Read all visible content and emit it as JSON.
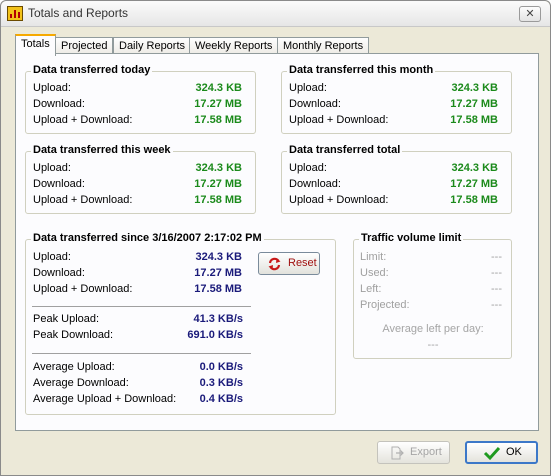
{
  "window": {
    "title": "Totals and Reports",
    "close_glyph": "✕"
  },
  "tabs": [
    "Totals",
    "Projected",
    "Daily Reports",
    "Weekly Reports",
    "Monthly Reports"
  ],
  "today": {
    "title": "Data transferred today",
    "upload_label": "Upload:",
    "upload": "324.3 KB",
    "download_label": "Download:",
    "download": "17.27 MB",
    "total_label": "Upload + Download:",
    "total": "17.58 MB"
  },
  "month": {
    "title": "Data transferred this month",
    "upload_label": "Upload:",
    "upload": "324.3 KB",
    "download_label": "Download:",
    "download": "17.27 MB",
    "total_label": "Upload + Download:",
    "total": "17.58 MB"
  },
  "week": {
    "title": "Data transferred this week",
    "upload_label": "Upload:",
    "upload": "324.3 KB",
    "download_label": "Download:",
    "download": "17.27 MB",
    "total_label": "Upload + Download:",
    "total": "17.58 MB"
  },
  "alltime": {
    "title": "Data transferred total",
    "upload_label": "Upload:",
    "upload": "324.3 KB",
    "download_label": "Download:",
    "download": "17.27 MB",
    "total_label": "Upload + Download:",
    "total": "17.58 MB"
  },
  "since": {
    "title": "Data transferred since 3/16/2007 2:17:02 PM",
    "upload_label": "Upload:",
    "upload": "324.3 KB",
    "download_label": "Download:",
    "download": "17.27 MB",
    "total_label": "Upload + Download:",
    "total": "17.58 MB",
    "peak_upload_label": "Peak Upload:",
    "peak_upload": "41.3 KB/s",
    "peak_download_label": "Peak Download:",
    "peak_download": "691.0 KB/s",
    "avg_upload_label": "Average Upload:",
    "avg_upload": "0.0 KB/s",
    "avg_download_label": "Average Download:",
    "avg_download": "0.3 KB/s",
    "avg_total_label": "Average Upload + Download:",
    "avg_total": "0.4 KB/s",
    "reset_label": "Reset"
  },
  "limit": {
    "title": "Traffic volume limit",
    "limit_label": "Limit:",
    "limit": "---",
    "used_label": "Used:",
    "used": "---",
    "left_label": "Left:",
    "left": "---",
    "projected_label": "Projected:",
    "projected": "---",
    "avg_left_label": "Average left per day:",
    "avg_left": "---"
  },
  "buttons": {
    "export_label": "Export",
    "ok_label": "OK"
  },
  "colors": {
    "value_green": "#1b8a1b",
    "value_navy": "#1a1a7a",
    "tab_highlight": "#f6a900"
  }
}
